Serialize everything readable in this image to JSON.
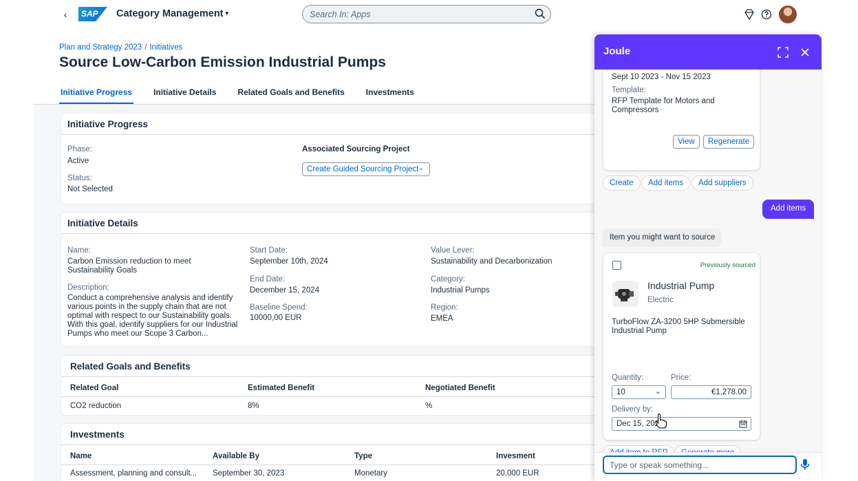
{
  "shell": {
    "logo": "SAP",
    "app_title": "Category Management",
    "search_placeholder": "Search In: Apps"
  },
  "page": {
    "breadcrumb": [
      "Plan and Strategy 2023",
      "Initiatives"
    ],
    "breadcrumb_sep": "/",
    "title": "Source Low-Carbon Emission Industrial Pumps",
    "tabs": [
      "Initiative Progress",
      "Initiative Details",
      "Related Goals and Benefits",
      "Investments"
    ]
  },
  "progress": {
    "title": "Initiative Progress",
    "phase_label": "Phase:",
    "phase_value": "Active",
    "status_label": "Status:",
    "status_value": "Not Selected",
    "assoc_label": "Associated Sourcing Project",
    "create_button": "Create Guided Sourcing Project"
  },
  "details": {
    "title": "Initiative Details",
    "name_label": "Name:",
    "name_value": "Carbon Emission reduction to meet Sustainability Goals",
    "description_label": "Description:",
    "description_value": "Conduct a comprehensive analysis and identify various points in the supply chain that are not optimal with respect to our Sustainability goals. With this goal, identify suppliers for our Industrial Pumps who meet our Scope 3 Carbon...",
    "start_label": "Start Date:",
    "start_value": "September 10th, 2024",
    "end_label": "End Date:",
    "end_value": "December 15, 2024",
    "baseline_label": "Baseline Spend:",
    "baseline_value": "10000,00 EUR",
    "lever_label": "Value Lever:",
    "lever_value": "Sustainability and Decarbonization",
    "category_label": "Category:",
    "category_value": "Industrial Pumps",
    "region_label": "Region:",
    "region_value": "EMEA"
  },
  "goals": {
    "title": "Related Goals and Benefits",
    "columns": [
      "Related Goal",
      "Estimated Benefit",
      "Negotiated Benefit"
    ],
    "rows": [
      [
        "CO2 reduction",
        "8%",
        "%"
      ]
    ]
  },
  "investments": {
    "title": "Investments",
    "columns": [
      "Name",
      "Available By",
      "Type",
      "Invesment"
    ],
    "rows": [
      [
        "Assessment, planning and consult...",
        "September 30, 2023",
        "Monetary",
        "20,000 EUR"
      ]
    ]
  },
  "joule": {
    "title": "Joule",
    "prev_card": {
      "dates": "Sept 10 2023 - Nov 15 2023",
      "template_label": "Template:",
      "template_value": "RFP Template for Motors and Compressors",
      "view_button": "View",
      "regenerate_button": "Regenerate"
    },
    "actions": [
      "Create",
      "Add items",
      "Add suppliers"
    ],
    "user_message": "Add items",
    "bot_message": "Item you might want to source",
    "item": {
      "badge": "Previously sourced",
      "name": "Industrial Pump",
      "subtitle": "Electric",
      "description": "TurboFlow ZA-3200 5HP Submersible Industrial Pump",
      "quantity_label": "Quantity:",
      "quantity_value": "10",
      "price_label": "Price:",
      "price_value": "€1,278.00",
      "delivery_label": "Delivery by:",
      "delivery_value": "Dec 15, 2024"
    },
    "item_actions": [
      "Add item to RFP",
      "Generate more"
    ],
    "input_placeholder": "Type or speak something..."
  },
  "colors": {
    "brand": "#0064d9",
    "joule": "#5d36ff"
  }
}
